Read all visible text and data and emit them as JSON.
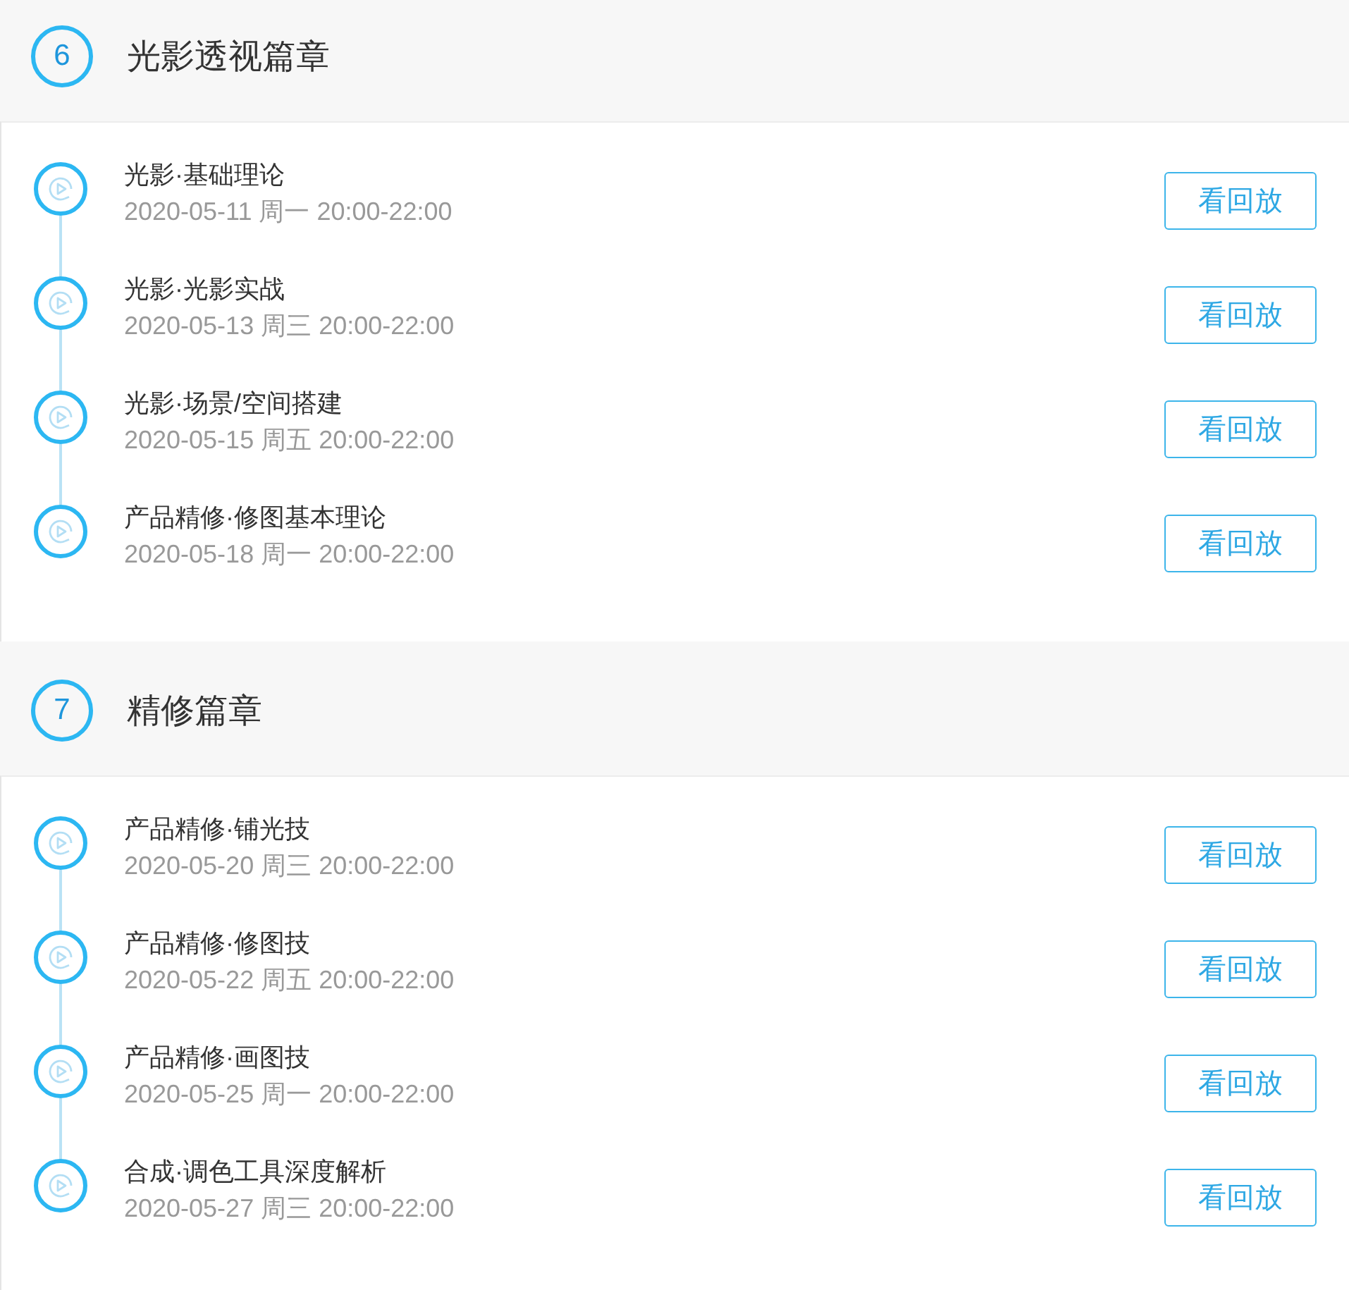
{
  "sections": [
    {
      "number": "6",
      "title": "光影透视篇章",
      "lessons": [
        {
          "title": "光影·基础理论",
          "time": "2020-05-11 周一 20:00-22:00",
          "button": "看回放"
        },
        {
          "title": "光影·光影实战",
          "time": "2020-05-13 周三 20:00-22:00",
          "button": "看回放"
        },
        {
          "title": "光影·场景/空间搭建",
          "time": "2020-05-15 周五 20:00-22:00",
          "button": "看回放"
        },
        {
          "title": "产品精修·修图基本理论",
          "time": "2020-05-18 周一 20:00-22:00",
          "button": "看回放"
        }
      ]
    },
    {
      "number": "7",
      "title": "精修篇章",
      "lessons": [
        {
          "title": "产品精修·铺光技",
          "time": "2020-05-20 周三 20:00-22:00",
          "button": "看回放"
        },
        {
          "title": "产品精修·修图技",
          "time": "2020-05-22 周五 20:00-22:00",
          "button": "看回放"
        },
        {
          "title": "产品精修·画图技",
          "time": "2020-05-25 周一 20:00-22:00",
          "button": "看回放"
        },
        {
          "title": "合成·调色工具深度解析",
          "time": "2020-05-27 周三 20:00-22:00",
          "button": "看回放"
        }
      ]
    }
  ]
}
